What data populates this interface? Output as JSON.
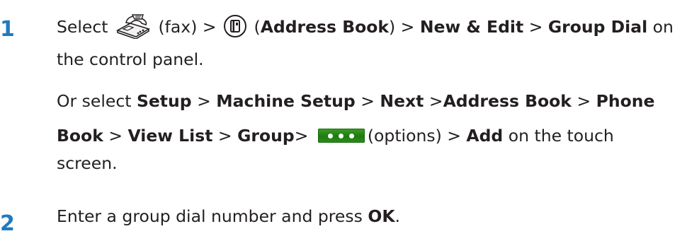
{
  "steps": [
    {
      "number": "1",
      "line1": {
        "select": "Select",
        "fax_label": "(fax) >",
        "paren_open": "(",
        "address_book": "Address Book",
        "after_address_book": ") >",
        "new_edit": "New & Edit",
        "sep": ">",
        "group_dial": "Group Dial",
        "tail": "on"
      },
      "line2": "the control panel.",
      "line3": {
        "prefix": "Or select",
        "setup": "Setup",
        "sep1": ">",
        "machine_setup": "Machine Setup",
        "sep2": ">",
        "next": "Next",
        "sep3": ">",
        "address_book": "Address Book",
        "sep4": ">",
        "phone": "Phone"
      },
      "line4": {
        "book": "Book",
        "sep1": ">",
        "view_list": "View List",
        "sep2": ">",
        "group": "Group",
        "sep3": ">",
        "options_label": "(options) >",
        "add": "Add",
        "tail": "on the touch"
      },
      "line5": "screen."
    },
    {
      "number": "2",
      "line1": {
        "text": "Enter a group dial number and press",
        "ok": "OK",
        "period": "."
      }
    }
  ],
  "icons": {
    "fax": "fax-icon",
    "address_book": "address-book-icon",
    "options": "options-button-icon"
  },
  "colors": {
    "step_number": "#1f7bbf",
    "text": "#231f20",
    "options_button": "#2b8d1a"
  }
}
